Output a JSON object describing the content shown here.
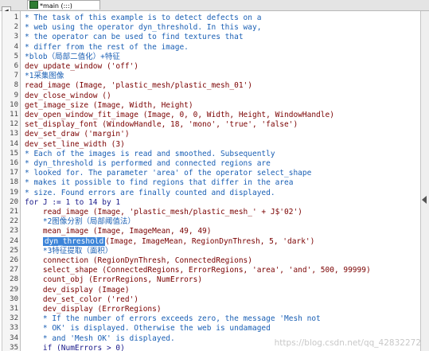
{
  "tab": {
    "title": "*main (:::)"
  },
  "watermark": "https://blog.csdn.net/qq_42832272",
  "lines": [
    {
      "n": "1",
      "text": "* The task of this example is to detect defects on a",
      "kind": "comment"
    },
    {
      "n": "2",
      "text": "* web using the operator dyn_threshold. In this way,",
      "kind": "comment"
    },
    {
      "n": "3",
      "text": "* the operator can be used to find textures that",
      "kind": "comment"
    },
    {
      "n": "4",
      "text": "* differ from the rest of the image.",
      "kind": "comment"
    },
    {
      "n": "5",
      "text": "*blob（局部二值化）+特征",
      "kind": "comment"
    },
    {
      "n": "6",
      "text": "dev_update_window ('off')",
      "kind": "op"
    },
    {
      "n": "7",
      "text": "*1采集图像",
      "kind": "comment"
    },
    {
      "n": "8",
      "text": "read_image (Image, 'plastic_mesh/plastic_mesh_01')",
      "kind": "op"
    },
    {
      "n": "9",
      "text": "dev_close_window ()",
      "kind": "op"
    },
    {
      "n": "10",
      "text": "get_image_size (Image, Width, Height)",
      "kind": "op"
    },
    {
      "n": "11",
      "text": "dev_open_window_fit_image (Image, 0, 0, Width, Height, WindowHandle)",
      "kind": "op"
    },
    {
      "n": "12",
      "text": "set_display_font (WindowHandle, 18, 'mono', 'true', 'false')",
      "kind": "op"
    },
    {
      "n": "13",
      "text": "dev_set_draw ('margin')",
      "kind": "op"
    },
    {
      "n": "14",
      "text": "dev_set_line_width (3)",
      "kind": "op"
    },
    {
      "n": "15",
      "text": "* Each of the images is read and smoothed. Subsequently",
      "kind": "comment"
    },
    {
      "n": "16",
      "text": "* dyn_threshold is performed and connected regions are",
      "kind": "comment"
    },
    {
      "n": "17",
      "text": "* looked for. The parameter 'area' of the operator select_shape",
      "kind": "comment"
    },
    {
      "n": "18",
      "text": "* makes it possible to find regions that differ in the area",
      "kind": "comment"
    },
    {
      "n": "19",
      "text": "* size. Found errors are finally counted and displayed.",
      "kind": "comment"
    },
    {
      "n": "20",
      "text": "for J := 1 to 14 by 1",
      "kind": "ctrl"
    },
    {
      "n": "21",
      "text": "    read_image (Image, 'plastic_mesh/plastic_mesh_' + J$'02')",
      "kind": "op"
    },
    {
      "n": "22",
      "text": "    *2图像分割（局部阈值法）",
      "kind": "comment"
    },
    {
      "n": "23",
      "text": "    mean_image (Image, ImageMean, 49, 49)",
      "kind": "op"
    },
    {
      "n": "24",
      "text": "(Image, ImageMean, RegionDynThresh, 5, 'dark')",
      "kind": "op",
      "selected": "dyn_threshold",
      "indent": "    "
    },
    {
      "n": "25",
      "text": "    *3特征提取（面积）",
      "kind": "comment"
    },
    {
      "n": "26",
      "text": "    connection (RegionDynThresh, ConnectedRegions)",
      "kind": "op"
    },
    {
      "n": "27",
      "text": "    select_shape (ConnectedRegions, ErrorRegions, 'area', 'and', 500, 99999)",
      "kind": "op"
    },
    {
      "n": "28",
      "text": "    count_obj (ErrorRegions, NumErrors)",
      "kind": "op"
    },
    {
      "n": "29",
      "text": "    dev_display (Image)",
      "kind": "op"
    },
    {
      "n": "30",
      "text": "    dev_set_color ('red')",
      "kind": "op"
    },
    {
      "n": "31",
      "text": "    dev_display (ErrorRegions)",
      "kind": "op"
    },
    {
      "n": "32",
      "text": "    * If the number of errors exceeds zero, the message 'Mesh not",
      "kind": "comment"
    },
    {
      "n": "33",
      "text": "    * OK' is displayed. Otherwise the web is undamaged",
      "kind": "comment"
    },
    {
      "n": "34",
      "text": "    * and 'Mesh OK' is displayed.",
      "kind": "comment"
    },
    {
      "n": "35",
      "text": "    if (NumErrors > 0)",
      "kind": "ctrl"
    }
  ]
}
